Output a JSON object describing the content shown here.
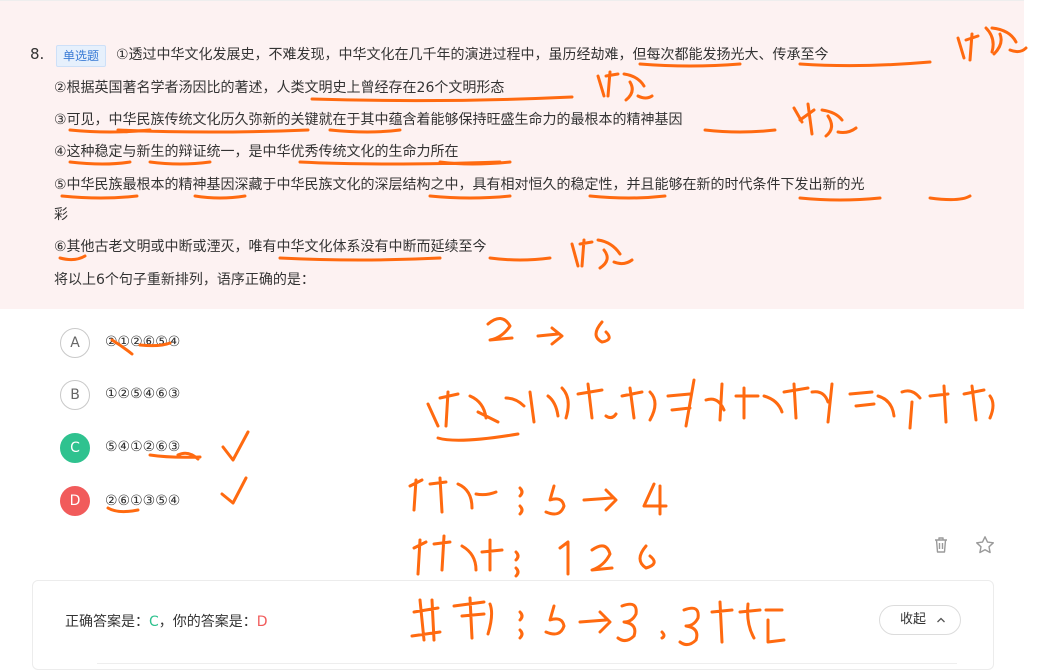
{
  "question": {
    "number": "8.",
    "type_tag": "单选题",
    "sentences": [
      "①透过中华文化发展史，不难发现，中华文化在几千年的演进过程中，虽历经劫难，但每次都能发扬光大、传承至今",
      "②根据英国著名学者汤因比的著述，人类文明史上曾经存在26个文明形态",
      "③可见，中华民族传统文化历久弥新的关键就在于其中蕴含着能够保持旺盛生命力的最根本的精神基因",
      "④这种稳定与新生的辩证统一，是中华优秀传统文化的生命力所在",
      "⑤中华民族最根本的精神基因深藏于中华民族文化的深层结构之中，具有相对恒久的稳定性，并且能够在新的时代条件下发出新的光",
      "彩",
      "⑥其他古老文明或中断或湮灭，唯有中华文化体系没有中断而延续至今"
    ],
    "prompt": "将以上6个句子重新排列，语序正确的是："
  },
  "options": [
    {
      "letter": "A",
      "text": "②①②⑥⑤④",
      "state": "plain"
    },
    {
      "letter": "B",
      "text": "①②⑤④⑥③",
      "state": "plain"
    },
    {
      "letter": "C",
      "text": "⑤④①②⑥③",
      "state": "correct"
    },
    {
      "letter": "D",
      "text": "②⑥①③⑤④",
      "state": "chosen"
    }
  ],
  "answer": {
    "correct_label": "正确答案是：",
    "correct_value": "C",
    "separator": "，你的答案是：",
    "user_value": "D",
    "collapse_label": "收起"
  },
  "icons": {
    "delete": "trash-icon",
    "favorite": "star-icon",
    "collapse": "chevron-up-icon"
  },
  "handwritten_notes": [
    "现象",
    "现象",
    "总结",
    "现象",
    "2 -> 6",
    "现象可能是引言，也可能是解释",
    "稳定：5 -> 4",
    "延续：1 2 6",
    "基因：5->3 ，3末尾"
  ],
  "colors": {
    "panel_bg": "#fdf2f2",
    "correct_green": "#2fc28f",
    "wrong_red": "#f15b5b",
    "ink_orange": "#ff6a10",
    "tag_blue": "#3a7bd5"
  }
}
